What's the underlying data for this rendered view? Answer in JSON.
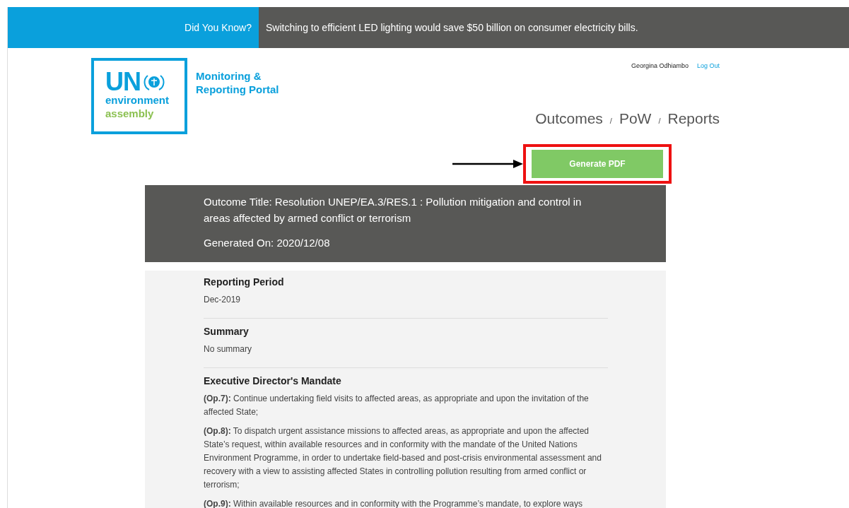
{
  "banner": {
    "label": "Did You Know?",
    "message": "Switching to efficient LED lighting would save $50 billion on consumer electricity bills."
  },
  "logo": {
    "acronym": "UN",
    "line_1": "environment",
    "line_2": "assembly"
  },
  "portal_title": [
    "Monitoring &",
    "Reporting Portal"
  ],
  "user": {
    "name": "Georgina Odhiambo",
    "logout": "Log Out"
  },
  "nav": [
    {
      "label": "Outcomes"
    },
    {
      "label": "PoW"
    },
    {
      "label": "Reports"
    }
  ],
  "nav_separator": "/",
  "generate_button": {
    "label": "Generate PDF",
    "highlighted": true
  },
  "outcome": {
    "title": "Outcome Title: Resolution UNEP/EA.3/RES.1 : Pollution mitigation and control in areas affected by armed conflict or terrorism",
    "generated": "Generated On: 2020/12/08"
  },
  "sections": [
    {
      "heading": "Reporting Period",
      "paragraphs": [
        "Dec-2019"
      ]
    },
    {
      "heading": "Summary",
      "paragraphs": [
        "No summary"
      ]
    },
    {
      "heading": "Executive Director's Mandate",
      "paragraphs": [
        "**(Op.7):** Continue undertaking field visits to affected areas, as appropriate and upon the invitation of the affected State;",
        "**(Op.8):** To dispatch urgent assistance missions to affected areas, as appropriate and upon the affected State’s request, within available resources and in conformity with the mandate of the United Nations Environment Programme, in order to undertake field-based and post-crisis environmental assessment and recovery with a view to assisting affected States in controlling pollution resulting from armed conflict or terrorism;",
        "**(Op.9):** Within available resources and in conformity with the Programme’s mandate, to explore ways"
      ]
    }
  ]
}
